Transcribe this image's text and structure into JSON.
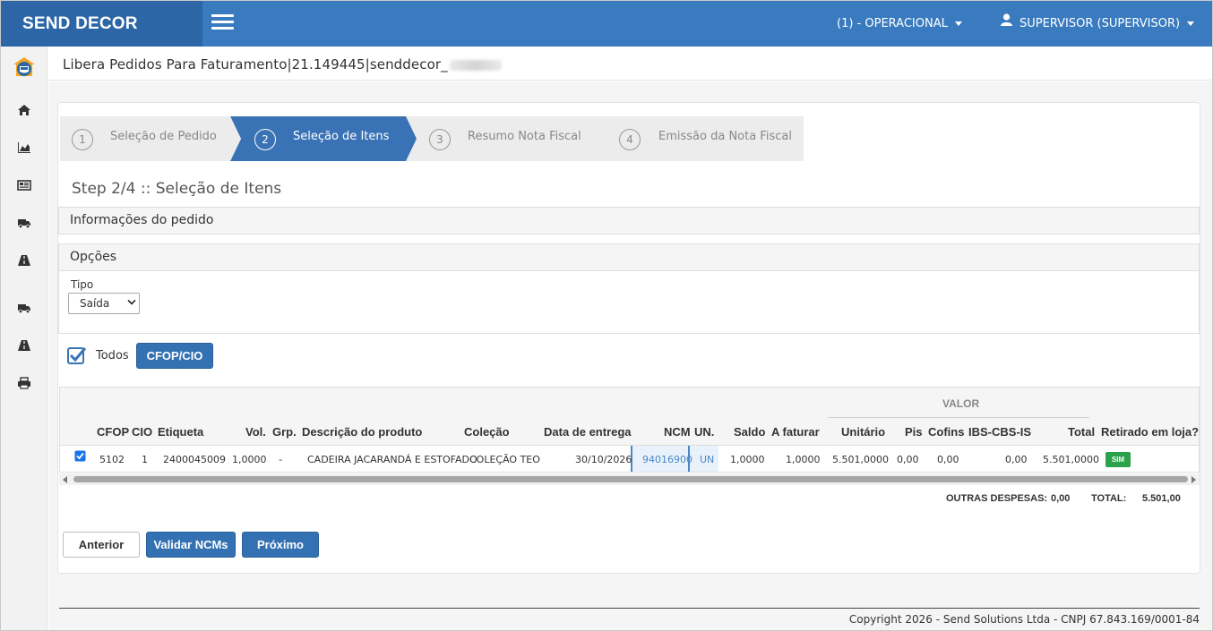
{
  "app": {
    "brand": "SEND DECOR"
  },
  "topbar": {
    "menu_operacional": "(1) - OPERACIONAL",
    "menu_user": "SUPERVISOR (SUPERVISOR)"
  },
  "sidebar": {
    "icons": [
      "logo-icon",
      "home-icon",
      "area-chart-icon",
      "newspaper-icon",
      "truck-icon",
      "road-icon",
      "truck-icon",
      "road-icon",
      "print-icon"
    ]
  },
  "page": {
    "header": "Libera Pedidos Para Faturamento|21.149445|senddecor_",
    "step_title": "Step 2/4 :: Seleção de Itens"
  },
  "wizard": {
    "steps": [
      {
        "num": "1",
        "label": "Seleção de Pedido"
      },
      {
        "num": "2",
        "label": "Seleção de Itens"
      },
      {
        "num": "3",
        "label": "Resumo Nota Fiscal"
      },
      {
        "num": "4",
        "label": "Emissão da Nota Fiscal"
      }
    ],
    "active_index": 1
  },
  "sections": {
    "info_pedido": "Informações do pedido",
    "opcoes": "Opções"
  },
  "options": {
    "tipo_label": "Tipo",
    "tipo_value": "Saída",
    "todos_label": "Todos",
    "todos_checked": true,
    "cfop_button": "CFOP/CIO"
  },
  "table": {
    "group_header": "VALOR",
    "columns": [
      "CFOP",
      "CIO",
      "Etiqueta",
      "Vol.",
      "Grp.",
      "Descrição do produto",
      "Coleção",
      "Data de entrega",
      "NCM",
      "UN.",
      "Saldo",
      "A faturar",
      "Unitário",
      "Pis",
      "Cofins",
      "IBS-CBS-IS",
      "Total",
      "Retirado em loja?"
    ],
    "rows": [
      {
        "checked": true,
        "cfop": "5102",
        "cio": "1",
        "etiqueta": "2400045009",
        "vol": "1,0000",
        "grp": "-",
        "descricao": "CADEIRA JACARANDÁ E ESTOFADO",
        "colecao": "COLEÇÃO TEO",
        "data_entrega": "30/10/2026",
        "ncm": "94016900",
        "un": "UN",
        "saldo": "1,0000",
        "a_faturar": "1,0000",
        "unitario": "5.501,0000",
        "pis": "0,00",
        "cofins": "0,00",
        "ibs_cbs_is": "0,00",
        "total": "5.501,0000",
        "retirado": "SIM"
      }
    ]
  },
  "totals": {
    "outras_label": "OUTRAS DESPESAS:",
    "outras_value": "0,00",
    "total_label": "TOTAL:",
    "total_value": "5.501,00"
  },
  "buttons": {
    "anterior": "Anterior",
    "validar": "Validar NCMs",
    "proximo": "Próximo"
  },
  "footer": {
    "copyright": "Copyright 2026 - Send Solutions Ltda - CNPJ 67.843.169/0001-84"
  },
  "colors": {
    "topbar": "#3a7bc0",
    "brand_bg": "#2c66a6",
    "active_step": "#3a73b5",
    "button": "#3371b3",
    "badge_green": "#2aa14a"
  }
}
